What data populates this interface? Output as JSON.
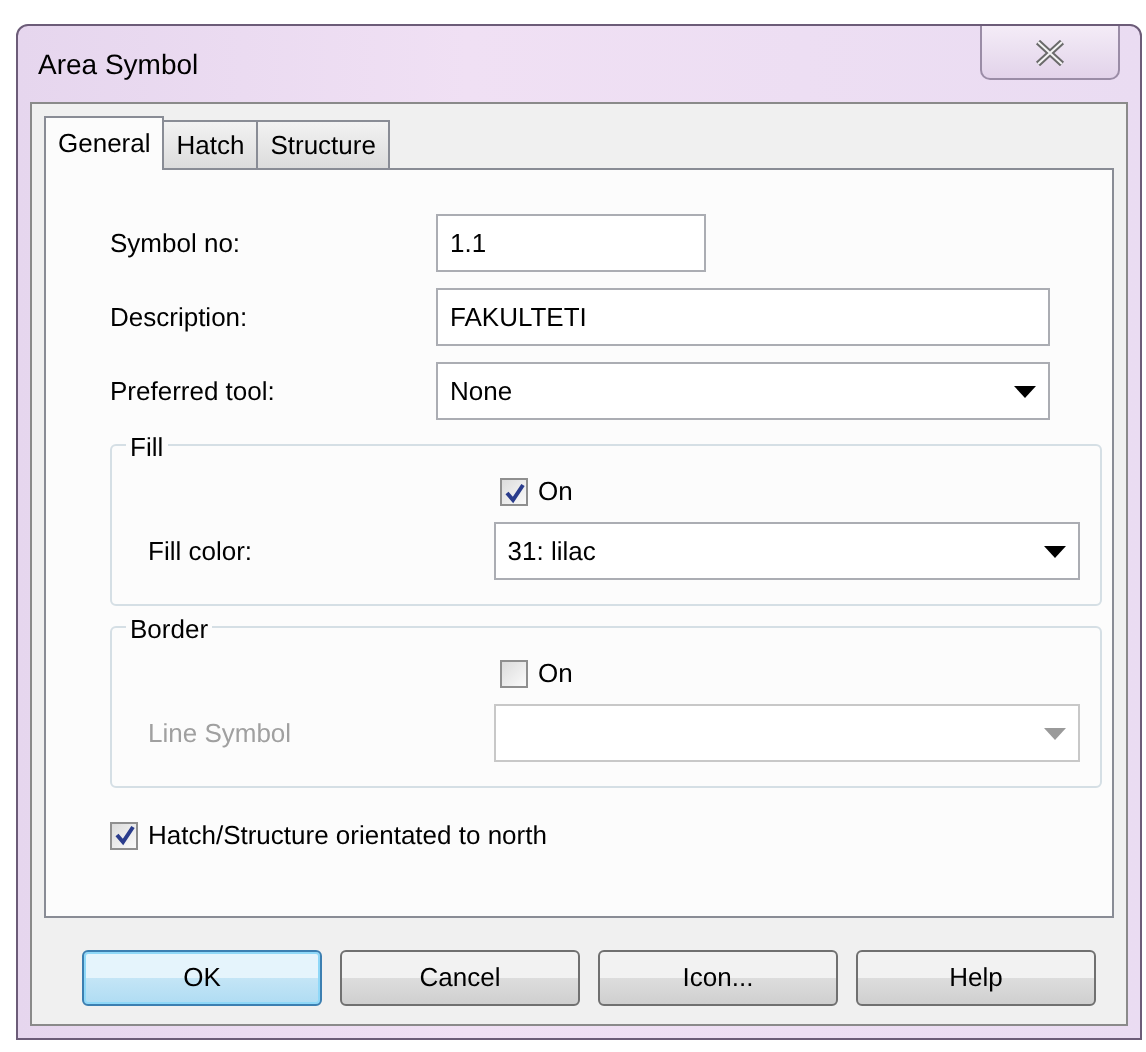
{
  "window": {
    "title": "Area Symbol"
  },
  "tabs": [
    {
      "label": "General",
      "selected": true
    },
    {
      "label": "Hatch",
      "selected": false
    },
    {
      "label": "Structure",
      "selected": false
    }
  ],
  "fields": [
    {
      "kind": "text",
      "label": "Symbol no:",
      "value": "1.1"
    },
    {
      "kind": "text",
      "label": "Description:",
      "value": "FAKULTETI"
    },
    {
      "kind": "select",
      "label": "Preferred tool:",
      "value": "None"
    }
  ],
  "groups": [
    {
      "title": "Fill",
      "checkbox": {
        "label": "On",
        "checked": true
      },
      "select": {
        "label": "Fill color:",
        "value": "31: lilac",
        "disabled": false
      }
    },
    {
      "title": "Border",
      "checkbox": {
        "label": "On",
        "checked": false
      },
      "select": {
        "label": "Line Symbol",
        "disabled": true
      }
    }
  ],
  "north": {
    "label": "Hatch/Structure orientated to north",
    "checked": true
  },
  "buttons": [
    {
      "label": "OK",
      "default": true
    },
    {
      "label": "Cancel",
      "default": false
    },
    {
      "label": "Icon...",
      "default": false
    },
    {
      "label": "Help",
      "default": false
    }
  ]
}
